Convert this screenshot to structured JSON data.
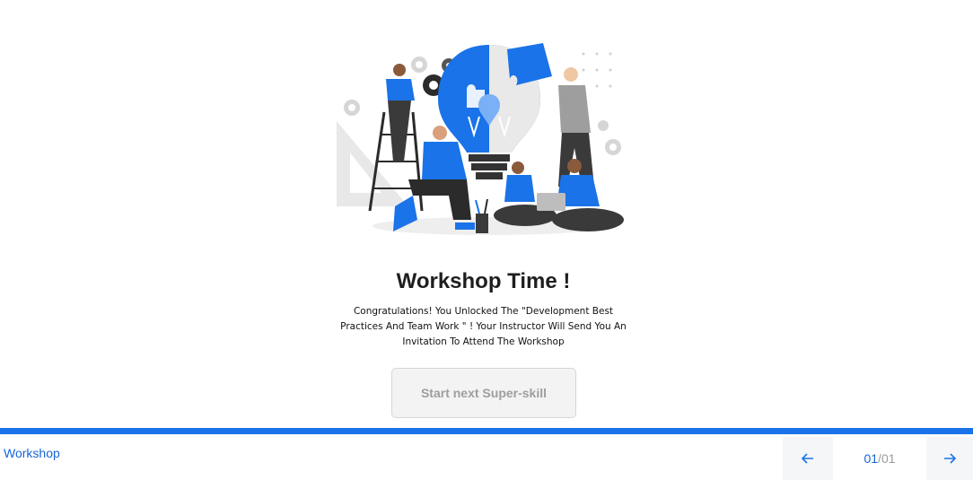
{
  "illustration": {
    "name": "team building lightbulb puzzle"
  },
  "content": {
    "title": "Workshop Time !",
    "message": "Congratulations! You Unlocked The \"Development Best Practices And Team Work \" ! Your Instructor Will Send You An Invitation To Attend The Workshop",
    "cta_label": "Start next Super-skill"
  },
  "progress": {
    "fraction": 1.0
  },
  "footer": {
    "label": "Workshop",
    "pager": {
      "current": "01",
      "separator": "/ ",
      "total": "01"
    },
    "prev_icon": "arrow-left-icon",
    "next_icon": "arrow-right-icon"
  },
  "colors": {
    "accent": "#1a73e8",
    "link": "#1565d8",
    "button_bg": "#f3f3f3",
    "button_text": "#9e9e9e"
  }
}
